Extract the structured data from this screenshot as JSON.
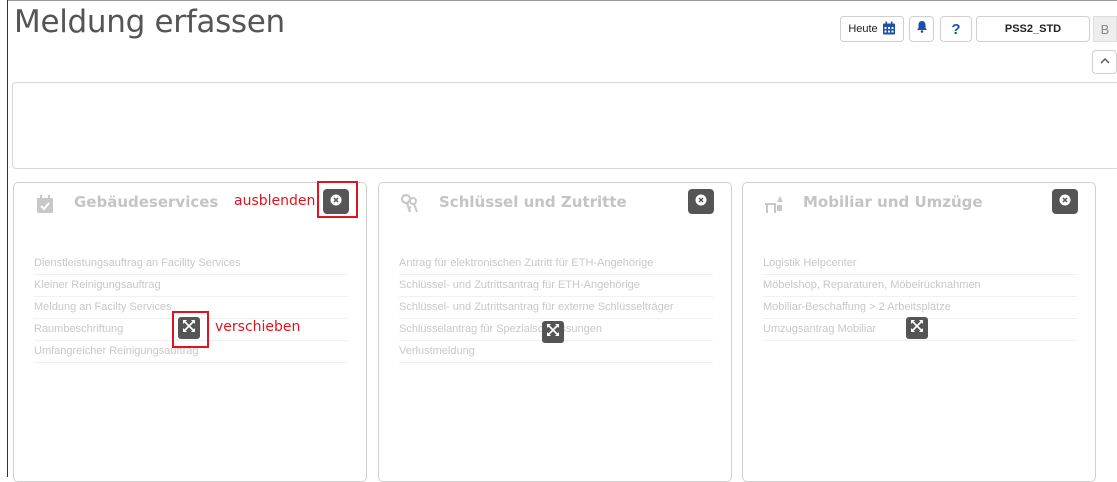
{
  "header": {
    "title": "Meldung erfassen",
    "today_label": "Heute",
    "help_label": "?",
    "user_value": "PSS2_STD",
    "avatar_letter": "B"
  },
  "cards": [
    {
      "title": "Gebäudeservices",
      "icon": "calendar-check-icon",
      "items": [
        "Dienstleistungsauftrag an Facility Services",
        "Kleiner Reinigungsauftrag",
        "Meldung an Facilty Services",
        "Raumbeschriftung",
        "Umfangreicher Reinigungsauftrag"
      ]
    },
    {
      "title": "Schlüssel und Zutritte",
      "icon": "keys-icon",
      "items": [
        "Antrag für elektronischen Zutritt für ETH-Angehörige",
        "Schlüssel- und Zutrittsantrag für ETH-Angehörige",
        "Schlüssel- und Zutrittsantrag für externe Schlüsselträger",
        "Schlüsselantrag für Spezialschliessungen",
        "Verlustmeldung"
      ]
    },
    {
      "title": "Mobiliar und Umzüge",
      "icon": "furniture-move-icon",
      "items": [
        "Logistik Helpcenter",
        "Möbelshop, Reparaturen, Möbelrücknahmen",
        "Mobiliar-Beschaffung > 2 Arbeitsplätze",
        "Umzugsantrag Mobiliar"
      ]
    }
  ],
  "annotations": {
    "hide_label": "ausblenden",
    "move_label": "verschieben"
  },
  "colors": {
    "annotation_red": "#e0141e",
    "button_dark": "#555555",
    "muted_text": "#c8c8c8",
    "help_blue": "#1f4fa8"
  }
}
